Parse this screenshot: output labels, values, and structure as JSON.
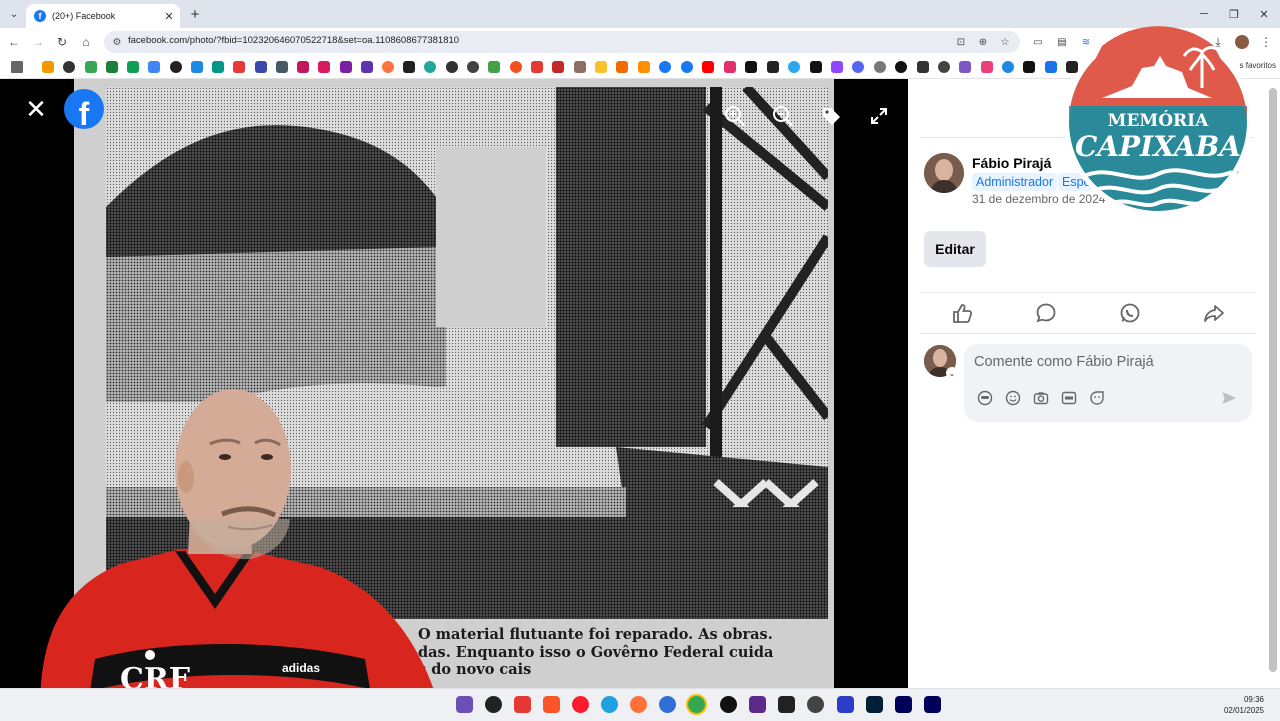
{
  "browser": {
    "tab_title": "(20+) Facebook",
    "tab_favicon": "f",
    "new_tab_symbol": "+",
    "url": "facebook.com/photo/?fbid=102320646070522718&set=oa.1108608677381810",
    "bookmarks_label": "s favoritos",
    "window_controls": [
      "─",
      "❐",
      "✕"
    ]
  },
  "viewer": {
    "fb_logo_letter": "f",
    "caption_lines": [
      "O material flutuante foi reparado. As obras.",
      "das. Enquanto isso o Govêrno Federal cuida",
      "s do novo cais"
    ],
    "icons": [
      "close-icon",
      "zoom-in-icon",
      "zoom-out-icon",
      "tag-icon",
      "fullscreen-icon"
    ]
  },
  "post": {
    "author": "Fábio Pirajá",
    "role": "Administrador",
    "role_partial": "Espe",
    "date": "31 de dezembro de 2024",
    "edit_label": "Editar",
    "actions": [
      "like-icon",
      "comment-icon",
      "whatsapp-icon",
      "share-icon"
    ],
    "comment_placeholder": "Comente como Fábio Pirajá",
    "comment_tools": [
      "avatar-sticker-icon",
      "emoji-icon",
      "camera-icon",
      "gif-icon",
      "sticker-icon"
    ]
  },
  "logo": {
    "line1": "MEMÓRIA",
    "line2": "CAPIXABA",
    "colors": {
      "red": "#e05a4b",
      "teal": "#2a8a99",
      "white": "#ffffff"
    }
  },
  "taskbar": {
    "time": "09:36",
    "date": "02/01/2025"
  },
  "colors": {
    "facebook_blue": "#1877f2",
    "jersey_red": "#d8251d"
  }
}
